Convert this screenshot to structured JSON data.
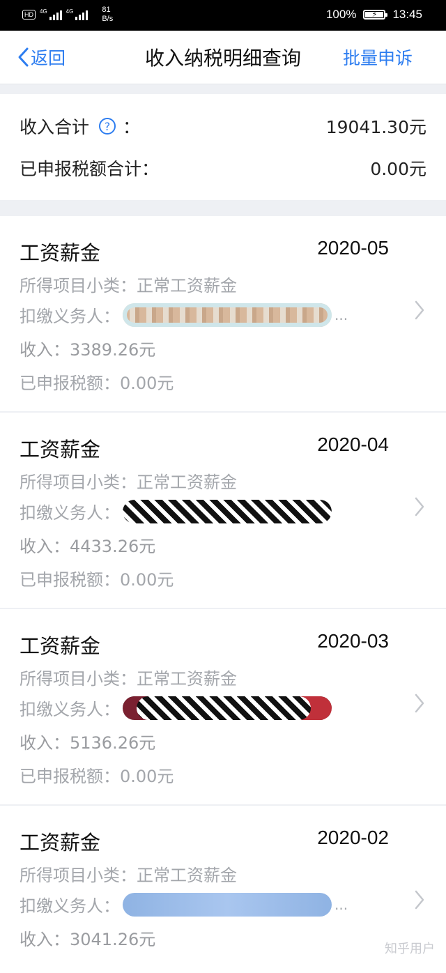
{
  "status_bar": {
    "hd_badge": "HD",
    "network_1": "4G",
    "network_2": "4G",
    "speed_value": "81",
    "speed_unit": "B/s",
    "battery": "100%",
    "time": "13:45"
  },
  "nav": {
    "back_label": "返回",
    "title": "收入纳税明细查询",
    "action_label": "批量申诉"
  },
  "summary": {
    "income_label": "收入合计",
    "help_glyph": "?",
    "colon": "：",
    "income_value": "19041.30元",
    "tax_label": "已申报税额合计：",
    "tax_value": "0.00元"
  },
  "records": [
    {
      "title": "工资薪金",
      "date": "2020-05",
      "subcategory": "所得项目小类：正常工资薪金",
      "payer_label": "扣缴义务人：",
      "income": "收入：3389.26元",
      "tax": "已申报税额：0.00元"
    },
    {
      "title": "工资薪金",
      "date": "2020-04",
      "subcategory": "所得项目小类：正常工资薪金",
      "payer_label": "扣缴义务人：",
      "income": "收入：4433.26元",
      "tax": "已申报税额：0.00元"
    },
    {
      "title": "工资薪金",
      "date": "2020-03",
      "subcategory": "所得项目小类：正常工资薪金",
      "payer_label": "扣缴义务人：",
      "income": "收入：5136.26元",
      "tax": "已申报税额：0.00元"
    },
    {
      "title": "工资薪金",
      "date": "2020-02",
      "subcategory": "所得项目小类：正常工资薪金",
      "payer_label": "扣缴义务人：",
      "income": "收入：3041.26元",
      "tax": ""
    }
  ],
  "ellipsis": "...",
  "watermark": "知乎用户",
  "colors": {
    "accent": "#2d7df0",
    "muted_text": "#a3a6ab",
    "background": "#eef0f4"
  },
  "icons": [
    "back-chevron-icon",
    "help-circle-icon",
    "chevron-right-icon"
  ]
}
